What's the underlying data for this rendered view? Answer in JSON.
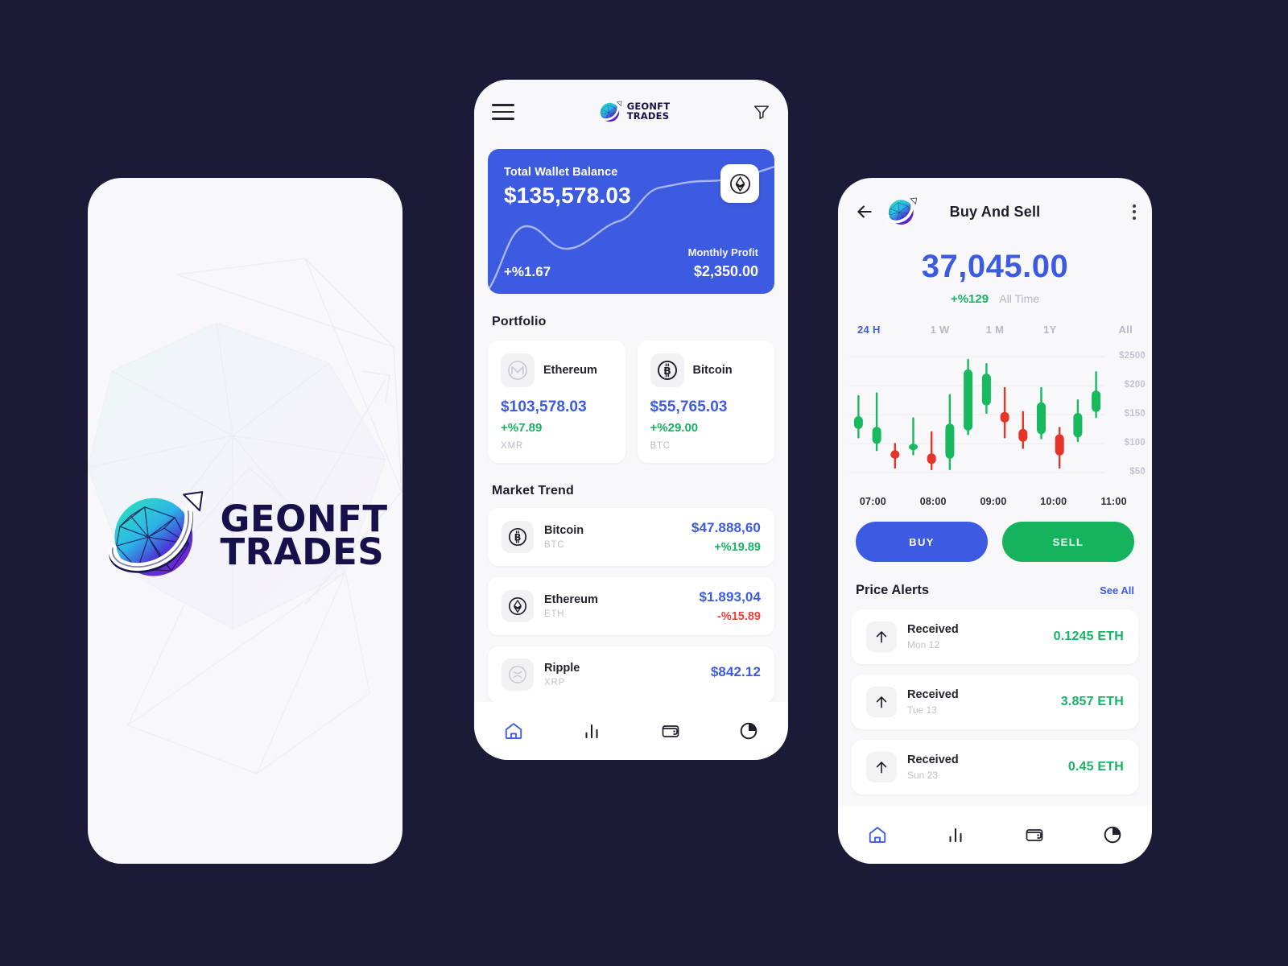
{
  "background_color": "#1b1b38",
  "brand": {
    "name_line1": "GEONFT",
    "name_line2": "TRADES",
    "logo_icon": "geonft-globe-arrow-logo"
  },
  "splash_screen": {
    "name": "splash-screen"
  },
  "wallet_screen": {
    "topbar": {
      "menu_icon": "hamburger-menu-icon",
      "filter_icon": "funnel-filter-icon"
    },
    "balance_card": {
      "label": "Total Wallet Balance",
      "amount": "$135,578.03",
      "change": "+%1.67",
      "profit_label": "Monthly Profit",
      "profit_value": "$2,350.00",
      "badge_icon": "ethereum-icon",
      "accent_color": "#3d5be0"
    },
    "portfolio": {
      "title": "Portfolio",
      "cards": [
        {
          "name": "Ethereum",
          "icon": "monero-icon",
          "price": "$103,578.03",
          "change": "+%7.89",
          "change_dir": "up",
          "symbol": "XMR"
        },
        {
          "name": "Bitcoin",
          "icon": "bitcoin-icon",
          "price": "$55,765.03",
          "change": "+%29.00",
          "change_dir": "up",
          "symbol": "BTC"
        }
      ]
    },
    "market_trend": {
      "title": "Market Trend",
      "items": [
        {
          "name": "Bitcoin",
          "icon": "bitcoin-icon",
          "symbol": "BTC",
          "value": "$47.888,60",
          "change": "+%19.89",
          "change_dir": "up"
        },
        {
          "name": "Ethereum",
          "icon": "ethereum-icon",
          "symbol": "ETH",
          "value": "$1.893,04",
          "change": "-%15.89",
          "change_dir": "down"
        },
        {
          "name": "Ripple",
          "icon": "ripple-icon",
          "symbol": "XRP",
          "value": "$842.12",
          "change": "",
          "change_dir": "up"
        }
      ]
    },
    "tabbar": [
      {
        "icon": "home-icon",
        "active": true
      },
      {
        "icon": "bar-chart-icon",
        "active": false
      },
      {
        "icon": "wallet-icon",
        "active": false
      },
      {
        "icon": "pie-chart-icon",
        "active": false
      }
    ]
  },
  "trade_screen": {
    "topbar": {
      "back_icon": "back-arrow-icon",
      "logo_icon": "geonft-globe-arrow-logo",
      "title": "Buy And Sell",
      "more_icon": "kebab-menu-icon"
    },
    "price": "37,045.00",
    "change": "+%129",
    "change_period": "All Time",
    "ranges": [
      {
        "label": "24 H",
        "active": true
      },
      {
        "label": "1 W",
        "active": false
      },
      {
        "label": "1 M",
        "active": false
      },
      {
        "label": "1Y",
        "active": false
      },
      {
        "label": "All",
        "active": false
      }
    ],
    "actions": {
      "buy_label": "BUY",
      "sell_label": "SELL",
      "buy_color": "#3d5be0",
      "sell_color": "#15b35d"
    },
    "alerts": {
      "title": "Price Alerts",
      "see_all": "See All",
      "items": [
        {
          "label": "Received",
          "date": "Mon 12",
          "amount": "0.1245 ETH",
          "icon": "arrow-up-icon"
        },
        {
          "label": "Received",
          "date": "Tue 13",
          "amount": "3.857 ETH",
          "icon": "arrow-up-icon"
        },
        {
          "label": "Received",
          "date": "Sun 23",
          "amount": "0.45 ETH",
          "icon": "arrow-up-icon"
        }
      ]
    },
    "tabbar": [
      {
        "icon": "home-icon",
        "active": true
      },
      {
        "icon": "bar-chart-icon",
        "active": false
      },
      {
        "icon": "wallet-icon",
        "active": false
      },
      {
        "icon": "pie-chart-icon",
        "active": false
      }
    ]
  },
  "chart_data": {
    "type": "candlestick",
    "title": "",
    "xlabel": "",
    "ylabel": "",
    "x_tick_labels": [
      "07:00",
      "08:00",
      "09:00",
      "10:00",
      "11:00"
    ],
    "y_tick_labels": [
      "$2500",
      "$200",
      "$150",
      "$100",
      "$50"
    ],
    "grid": true,
    "legend": "none",
    "up_color": "#18b95f",
    "down_color": "#e5342a",
    "ylim": [
      50,
      2500
    ],
    "candles": [
      {
        "open": 128,
        "close": 152,
        "low": 112,
        "high": 190,
        "dir": "up"
      },
      {
        "open": 100,
        "close": 132,
        "low": 88,
        "high": 195,
        "dir": "up"
      },
      {
        "open": 72,
        "close": 88,
        "low": 55,
        "high": 100,
        "dir": "down"
      },
      {
        "open": 88,
        "close": 100,
        "low": 80,
        "high": 148,
        "dir": "up"
      },
      {
        "open": 62,
        "close": 82,
        "low": 52,
        "high": 122,
        "dir": "down"
      },
      {
        "open": 72,
        "close": 138,
        "low": 52,
        "high": 192,
        "dir": "up"
      },
      {
        "open": 125,
        "close": 240,
        "low": 118,
        "high": 258,
        "dir": "up"
      },
      {
        "open": 172,
        "close": 232,
        "low": 158,
        "high": 250,
        "dir": "up"
      },
      {
        "open": 140,
        "close": 160,
        "low": 112,
        "high": 205,
        "dir": "down"
      },
      {
        "open": 104,
        "close": 128,
        "low": 92,
        "high": 160,
        "dir": "down"
      },
      {
        "open": 118,
        "close": 178,
        "low": 110,
        "high": 205,
        "dir": "up"
      },
      {
        "open": 78,
        "close": 118,
        "low": 55,
        "high": 130,
        "dir": "down"
      },
      {
        "open": 112,
        "close": 158,
        "low": 105,
        "high": 182,
        "dir": "up"
      },
      {
        "open": 160,
        "close": 200,
        "low": 150,
        "high": 235,
        "dir": "up"
      }
    ]
  }
}
